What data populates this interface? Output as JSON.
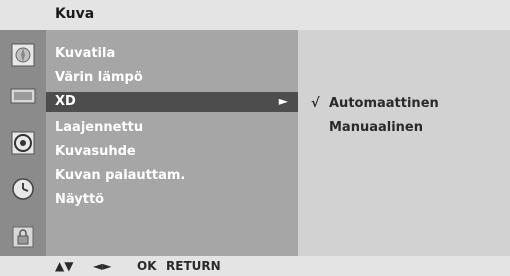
{
  "title": "Kuva",
  "menu": {
    "items": [
      "Kuvatila",
      "Värin lämpö",
      "XD",
      "Laajennettu",
      "Kuvasuhde",
      "Kuvan palauttam.",
      "Näyttö"
    ],
    "selected_arrow": "►"
  },
  "submenu": {
    "check": "√",
    "options": [
      "Automaattinen",
      "Manuaalinen"
    ]
  },
  "footer": {
    "updown": "▲▼",
    "leftright": "◄►",
    "ok": "OK",
    "return": "RETURN"
  },
  "sidebar_icons": [
    "picture-icon",
    "screen-icon",
    "audio-icon",
    "time-icon",
    "lock-icon"
  ],
  "colors": {
    "title_bg": "#e4e4e4",
    "menu_bg": "#a6a6a6",
    "selected_bg": "#4d4d4d",
    "submenu_bg": "#d2d2d2",
    "sidebar_bg": "#8b8b8b"
  }
}
